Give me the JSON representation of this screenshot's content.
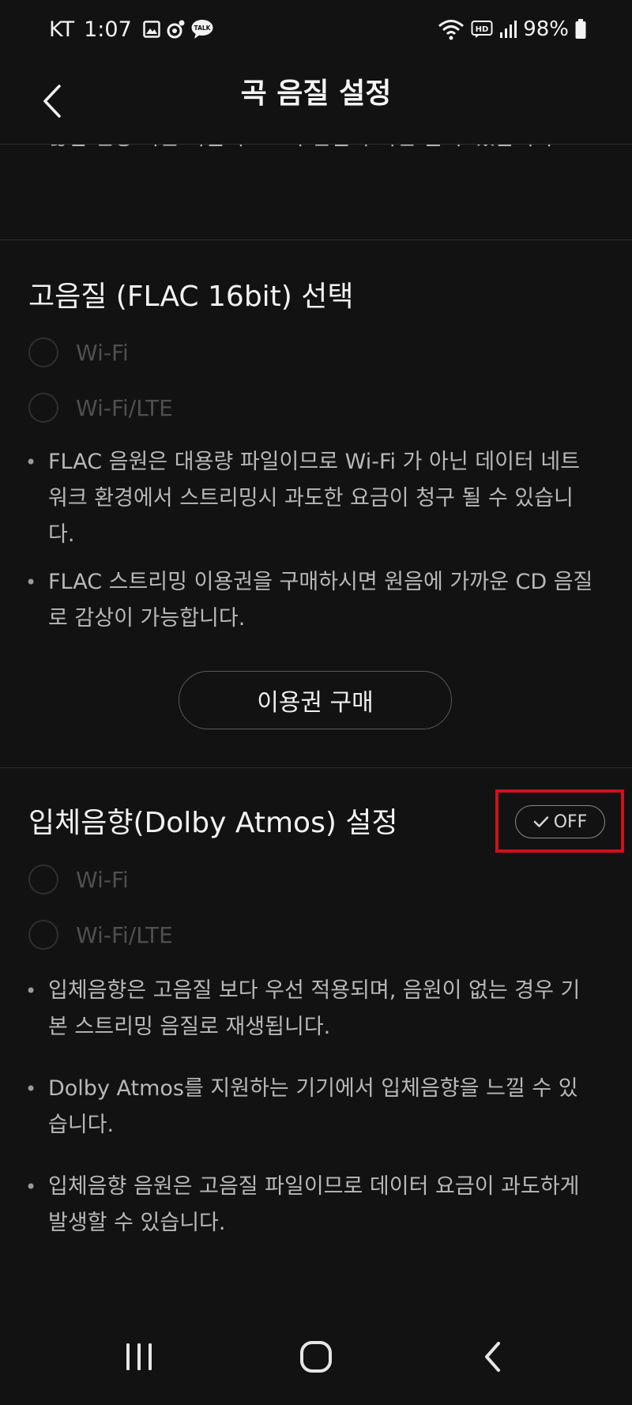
{
  "status_bar": {
    "carrier": "KT",
    "time": "1:07",
    "battery": "98%",
    "hd_label": "HD",
    "talk_label": "TALK"
  },
  "header": {
    "title": "곡 음질 설정"
  },
  "top_note": "끊김 현상 혹은 다음곡으로의 연결이 지연 될 수 있습니다.",
  "flac_section": {
    "title": "고음질 (FLAC 16bit) 선택",
    "options": [
      "Wi-Fi",
      "Wi-Fi/LTE"
    ],
    "notes": [
      "FLAC 음원은 대용량 파일이므로 Wi-Fi 가 아닌 데이터 네트워크 환경에서 스트리밍시 과도한 요금이 청구 될 수 있습니다.",
      "FLAC 스트리밍 이용권을 구매하시면 원음에 가까운 CD 음질로 감상이 가능합니다."
    ],
    "purchase_label": "이용권 구매"
  },
  "dolby_section": {
    "title": "입체음향(Dolby Atmos) 설정",
    "toggle_label": "OFF",
    "options": [
      "Wi-Fi",
      "Wi-Fi/LTE"
    ],
    "notes": [
      "입체음향은 고음질 보다 우선 적용되며, 음원이 없는 경우 기본 스트리밍 음질로 재생됩니다.",
      "Dolby Atmos를 지원하는 기기에서 입체음향을 느낄 수 있습니다.",
      "입체음향 음원은 고음질 파일이므로 데이터 요금이 과도하게 발생할 수 있습니다."
    ]
  },
  "colors": {
    "background": "#121212",
    "highlight": "#d0101a",
    "disabled": "#4f4f4f"
  }
}
